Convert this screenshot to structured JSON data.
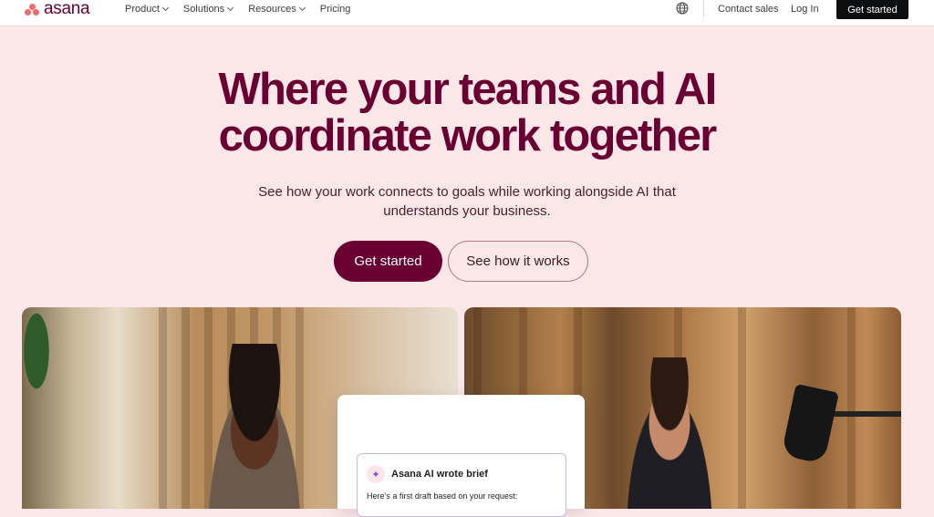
{
  "nav": {
    "logo_text": "asana",
    "links": [
      {
        "label": "Product",
        "dropdown": true
      },
      {
        "label": "Solutions",
        "dropdown": true
      },
      {
        "label": "Resources",
        "dropdown": true
      },
      {
        "label": "Pricing",
        "dropdown": false
      }
    ],
    "globe_icon": "globe-icon",
    "contact_label": "Contact sales",
    "login_label": "Log In",
    "cta_label": "Get started"
  },
  "hero": {
    "title_line1": "Where your teams and AI",
    "title_line2": "coordinate work together",
    "subtitle_line1": "See how your work connects to goals while working alongside AI that",
    "subtitle_line2": "understands your business.",
    "primary_button": "Get started",
    "secondary_button": "See how it works"
  },
  "card": {
    "ai_title": "Asana AI wrote brief",
    "ai_body": "Here’s a first draft based on your request:",
    "ai_icon": "sparkle-icon"
  },
  "colors": {
    "brand": "#690031",
    "background": "#fbe6e8",
    "logo_dots": "#f06a6a",
    "nav_cta": "#0d0e10"
  }
}
